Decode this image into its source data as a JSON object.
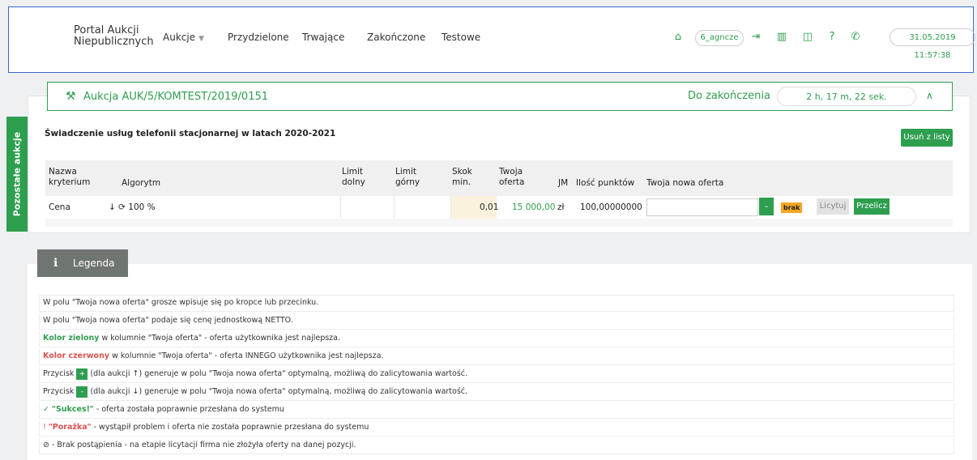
{
  "navbar": {
    "brand_line1": "Portal Aukcji",
    "brand_line2": "Niepublicznych",
    "menu": [
      "Aukcje",
      "Przydzielone",
      "Trwające",
      "Zakończone",
      "Testowe"
    ],
    "user": "6_agncze",
    "datetime": "31.05.2019 11:57:38",
    "icons": [
      "home-icon",
      "logout-icon",
      "building-icon",
      "book-icon",
      "help-icon",
      "phone-icon"
    ]
  },
  "side_tab": {
    "label": "Pozostałe aukcje"
  },
  "auction": {
    "title": "Aukcja AUK/5/KOMTEST/2019/0151",
    "end_label": "Do zakończenia",
    "timer": "2 h, 17 m, 22 sek.",
    "subject": "Świadczenie usług telefonii stacjonarnej w latach 2020-2021",
    "remove_label": "Usuń z listy"
  },
  "table": {
    "headers": {
      "criterion": [
        "Nazwa",
        "kryterium"
      ],
      "algorithm": "Algorytm",
      "limit_low": [
        "Limit",
        "dolny"
      ],
      "limit_high": [
        "Limit",
        "górny"
      ],
      "step": [
        "Skok",
        "min."
      ],
      "your_offer": [
        "Twoja",
        "oferta"
      ],
      "unit": "JM",
      "points": "Ilość punktów",
      "new_offer": "Twoja nowa oferta"
    },
    "row": {
      "criterion": "Cena",
      "algorithm": "↓ ⟳ 100 %",
      "limit_low": "",
      "limit_high": "",
      "step": "0,01",
      "your_offer": "15 000,00",
      "unit": "zł",
      "points": "100,00000000",
      "minus": "-",
      "status": "brak",
      "bid_label": "Licytuj",
      "recalc_label": "Przelicz"
    }
  },
  "legend": {
    "title": "Legenda",
    "items": [
      {
        "text": "W polu \"Twoja nowa oferta\" grosze wpisuje się po kropce lub przecinku."
      },
      {
        "text": "W polu \"Twoja nowa oferta\" podaje się cenę jednostkową NETTO."
      },
      {
        "prefix": "Kolor zielony",
        "text": " w kolumnie \"Twoja oferta\" - oferta użytkownika jest najlepsza."
      },
      {
        "prefix": "Kolor czerwony",
        "text": " w kolumnie \"Twoja oferta\" - oferta INNEGO użytkownika jest najlepsza."
      },
      {
        "prefix": "Przycisk",
        "btn": "+",
        "text": " (dla aukcji ↑) generuje w polu \"Twoja nowa oferta\" optymalną, możliwą do zalicytowania wartość."
      },
      {
        "prefix": "Przycisk",
        "btn": "-",
        "text": " (dla aukcji ↓) generuje w polu \"Twoja nowa oferta\" optymalną, możliwą do zalicytowania wartość."
      },
      {
        "icon": "✓",
        "bold": "\"Sukces!\"",
        "text": " - oferta została poprawnie przesłana do systemu"
      },
      {
        "icon": "!",
        "bold": "\"Porażka\"",
        "text": " - wystąpił problem i oferta nie została poprawnie przesłana do systemu"
      },
      {
        "icon": "⊘",
        "text": " - Brak postąpienia - na etapie licytacji firma nie złożyła oferty na danej pozycji."
      }
    ]
  },
  "colors": {
    "accent": "#2e9e4f",
    "danger": "#d9534f",
    "badge": "#f5a623"
  }
}
